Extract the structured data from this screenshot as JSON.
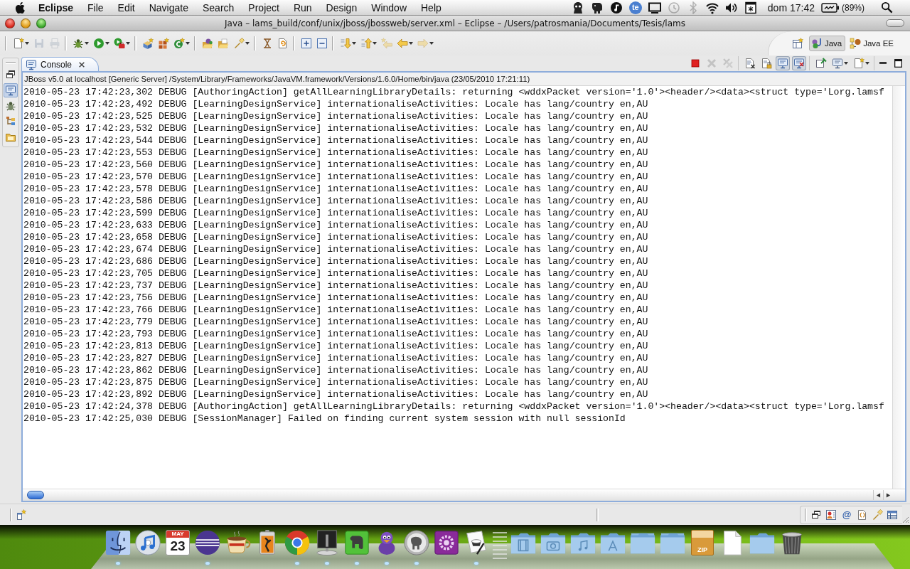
{
  "menu_bar": {
    "app_name": "Eclipse",
    "menus": [
      "File",
      "Edit",
      "Navigate",
      "Search",
      "Project",
      "Run",
      "Design",
      "Window",
      "Help"
    ],
    "status_icons": [
      {
        "kind": "monster",
        "dimmed": false
      },
      {
        "kind": "elephant",
        "dimmed": false
      },
      {
        "kind": "note",
        "dimmed": false
      },
      {
        "kind": "badge",
        "label": "te",
        "dimmed": false
      },
      {
        "kind": "display",
        "dimmed": false
      },
      {
        "kind": "clock",
        "dimmed": true
      },
      {
        "kind": "bluetooth",
        "dimmed": true
      },
      {
        "kind": "wifi",
        "dimmed": false
      },
      {
        "kind": "speaker",
        "dimmed": false
      },
      {
        "kind": "calendar",
        "dimmed": false
      }
    ],
    "clock": "dom 17:42",
    "battery": "(89%)"
  },
  "window": {
    "title": "Java – lams_build/conf/unix/jboss/jbossweb/server.xml – Eclipse – /Users/patrosmania/Documents/Tesis/lams"
  },
  "toolbar": {
    "groups": [
      [
        {
          "kind": "new",
          "dropdown": true,
          "disabled": false
        },
        {
          "kind": "save",
          "dropdown": false,
          "disabled": true
        },
        {
          "kind": "print",
          "dropdown": false,
          "disabled": true
        }
      ],
      [
        {
          "kind": "debug",
          "dropdown": true,
          "disabled": false
        },
        {
          "kind": "run",
          "dropdown": true,
          "disabled": false
        },
        {
          "kind": "external",
          "dropdown": true,
          "disabled": false
        }
      ],
      [
        {
          "kind": "package",
          "dropdown": false,
          "disabled": false
        },
        {
          "kind": "class",
          "dropdown": false,
          "disabled": false
        },
        {
          "kind": "wizard",
          "dropdown": true,
          "disabled": false
        }
      ],
      [
        {
          "kind": "opentype",
          "dropdown": false,
          "disabled": false
        },
        {
          "kind": "opentask",
          "dropdown": false,
          "disabled": false
        },
        {
          "kind": "search",
          "dropdown": true,
          "disabled": false
        }
      ],
      [
        {
          "kind": "marks",
          "dropdown": false,
          "disabled": false
        },
        {
          "kind": "refresh",
          "dropdown": false,
          "disabled": false
        }
      ],
      [
        {
          "kind": "expand",
          "dropdown": false,
          "disabled": false
        },
        {
          "kind": "collapse",
          "dropdown": false,
          "disabled": false
        }
      ],
      [
        {
          "kind": "next",
          "dropdown": true,
          "disabled": false
        },
        {
          "kind": "prev",
          "dropdown": true,
          "disabled": false
        },
        {
          "kind": "lastedit",
          "dropdown": false,
          "disabled": true
        },
        {
          "kind": "back",
          "dropdown": true,
          "disabled": false
        },
        {
          "kind": "forward",
          "dropdown": true,
          "disabled": true
        }
      ]
    ]
  },
  "perspectives": [
    {
      "kind": "java",
      "label": "Java",
      "selected": true
    },
    {
      "kind": "javaee",
      "label": "Java EE",
      "selected": false
    }
  ],
  "side_trim": [
    {
      "kind": "restore",
      "selected": false
    },
    {
      "kind": "console",
      "selected": true
    },
    {
      "kind": "bug",
      "selected": false
    },
    {
      "kind": "tree",
      "selected": false
    },
    {
      "kind": "folder",
      "selected": false
    }
  ],
  "console": {
    "tab": "Console",
    "toolbar": [
      [
        {
          "kind": "stop",
          "disabled": false,
          "pressed": false,
          "dropdown": false
        },
        {
          "kind": "remove",
          "disabled": true,
          "pressed": false,
          "dropdown": false
        },
        {
          "kind": "removeall",
          "disabled": true,
          "pressed": false,
          "dropdown": false
        }
      ],
      [
        {
          "kind": "clear",
          "disabled": false,
          "pressed": false,
          "dropdown": false
        },
        {
          "kind": "lock",
          "disabled": false,
          "pressed": false,
          "dropdown": false
        },
        {
          "kind": "stdout",
          "disabled": false,
          "pressed": true,
          "dropdown": false
        },
        {
          "kind": "stderr",
          "disabled": false,
          "pressed": true,
          "dropdown": false
        }
      ],
      [
        {
          "kind": "pin",
          "disabled": false,
          "pressed": false,
          "dropdown": false
        },
        {
          "kind": "display",
          "disabled": false,
          "pressed": false,
          "dropdown": true
        },
        {
          "kind": "open",
          "disabled": false,
          "pressed": false,
          "dropdown": true
        }
      ]
    ],
    "description": "JBoss v5.0 at localhost [Generic Server] /System/Library/Frameworks/JavaVM.framework/Versions/1.6.0/Home/bin/java (23/05/2010 17:21:11)",
    "lines": [
      "2010-05-23 17:42:23,302 DEBUG [AuthoringAction] getAllLearningLibraryDetails: returning <wddxPacket version='1.0'><header/><data><struct type='Lorg.lamsf",
      "2010-05-23 17:42:23,492 DEBUG [LearningDesignService] internationaliseActivities: Locale has lang/country en,AU",
      "2010-05-23 17:42:23,525 DEBUG [LearningDesignService] internationaliseActivities: Locale has lang/country en,AU",
      "2010-05-23 17:42:23,532 DEBUG [LearningDesignService] internationaliseActivities: Locale has lang/country en,AU",
      "2010-05-23 17:42:23,544 DEBUG [LearningDesignService] internationaliseActivities: Locale has lang/country en,AU",
      "2010-05-23 17:42:23,553 DEBUG [LearningDesignService] internationaliseActivities: Locale has lang/country en,AU",
      "2010-05-23 17:42:23,560 DEBUG [LearningDesignService] internationaliseActivities: Locale has lang/country en,AU",
      "2010-05-23 17:42:23,570 DEBUG [LearningDesignService] internationaliseActivities: Locale has lang/country en,AU",
      "2010-05-23 17:42:23,578 DEBUG [LearningDesignService] internationaliseActivities: Locale has lang/country en,AU",
      "2010-05-23 17:42:23,586 DEBUG [LearningDesignService] internationaliseActivities: Locale has lang/country en,AU",
      "2010-05-23 17:42:23,599 DEBUG [LearningDesignService] internationaliseActivities: Locale has lang/country en,AU",
      "2010-05-23 17:42:23,633 DEBUG [LearningDesignService] internationaliseActivities: Locale has lang/country en,AU",
      "2010-05-23 17:42:23,658 DEBUG [LearningDesignService] internationaliseActivities: Locale has lang/country en,AU",
      "2010-05-23 17:42:23,674 DEBUG [LearningDesignService] internationaliseActivities: Locale has lang/country en,AU",
      "2010-05-23 17:42:23,686 DEBUG [LearningDesignService] internationaliseActivities: Locale has lang/country en,AU",
      "2010-05-23 17:42:23,705 DEBUG [LearningDesignService] internationaliseActivities: Locale has lang/country en,AU",
      "2010-05-23 17:42:23,737 DEBUG [LearningDesignService] internationaliseActivities: Locale has lang/country en,AU",
      "2010-05-23 17:42:23,756 DEBUG [LearningDesignService] internationaliseActivities: Locale has lang/country en,AU",
      "2010-05-23 17:42:23,766 DEBUG [LearningDesignService] internationaliseActivities: Locale has lang/country en,AU",
      "2010-05-23 17:42:23,779 DEBUG [LearningDesignService] internationaliseActivities: Locale has lang/country en,AU",
      "2010-05-23 17:42:23,793 DEBUG [LearningDesignService] internationaliseActivities: Locale has lang/country en,AU",
      "2010-05-23 17:42:23,813 DEBUG [LearningDesignService] internationaliseActivities: Locale has lang/country en,AU",
      "2010-05-23 17:42:23,827 DEBUG [LearningDesignService] internationaliseActivities: Locale has lang/country en,AU",
      "2010-05-23 17:42:23,862 DEBUG [LearningDesignService] internationaliseActivities: Locale has lang/country en,AU",
      "2010-05-23 17:42:23,875 DEBUG [LearningDesignService] internationaliseActivities: Locale has lang/country en,AU",
      "2010-05-23 17:42:23,892 DEBUG [LearningDesignService] internationaliseActivities: Locale has lang/country en,AU",
      "2010-05-23 17:42:24,378 DEBUG [AuthoringAction] getAllLearningLibraryDetails: returning <wddxPacket version='1.0'><header/><data><struct type='Lorg.lamsf",
      "2010-05-23 17:42:25,030 DEBUG [SessionManager] Failed on finding current system session with null sessionId"
    ]
  },
  "status_bar": {
    "trim_items": [
      {
        "kind": "restore"
      },
      {
        "kind": "card"
      },
      {
        "kind": "glyph",
        "label": "@"
      },
      {
        "kind": "braces"
      },
      {
        "kind": "flashlight"
      },
      {
        "kind": "table"
      }
    ]
  },
  "dock": {
    "apps": [
      {
        "kind": "finder",
        "running": true
      },
      {
        "kind": "disc",
        "running": false
      },
      {
        "kind": "calendar",
        "month": "MAY",
        "day": "23",
        "running": false
      },
      {
        "kind": "sphere",
        "running": true
      },
      {
        "kind": "cup",
        "running": false
      },
      {
        "kind": "pass",
        "running": false
      },
      {
        "kind": "browser",
        "running": true
      },
      {
        "kind": "picture",
        "running": true
      },
      {
        "kind": "notes",
        "running": true
      },
      {
        "kind": "duck",
        "running": true
      },
      {
        "kind": "elephant",
        "running": true
      },
      {
        "kind": "gear",
        "running": false
      },
      {
        "kind": "script",
        "running": true
      }
    ],
    "stacks": [
      {
        "kind": "movies"
      },
      {
        "kind": "pictures"
      },
      {
        "kind": "music"
      },
      {
        "kind": "applications"
      },
      {
        "kind": "stack"
      },
      {
        "kind": "stack"
      },
      {
        "kind": "archive",
        "label": "ZIP"
      },
      {
        "kind": "document"
      },
      {
        "kind": "folder"
      },
      {
        "kind": "trash"
      }
    ]
  }
}
